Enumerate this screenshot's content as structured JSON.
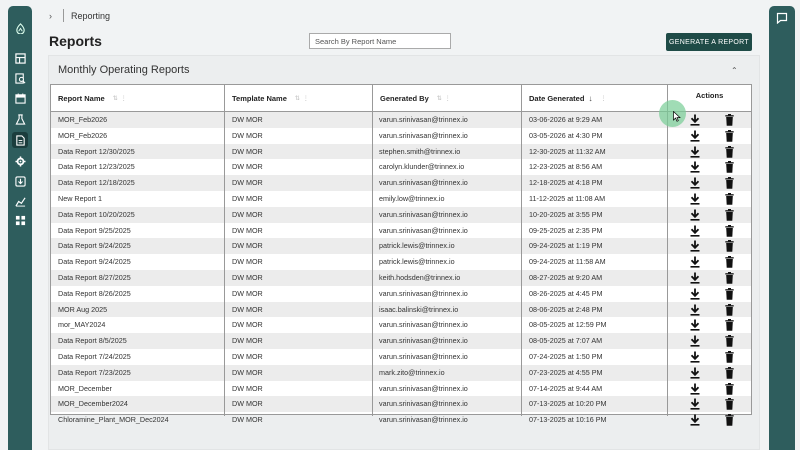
{
  "breadcrumb": {
    "chevron": "›",
    "label": "Reporting"
  },
  "page": {
    "title": "Reports"
  },
  "search": {
    "placeholder": "Search By Report Name"
  },
  "toolbar": {
    "generate_label": "GENERATE A REPORT"
  },
  "panel": {
    "title": "Monthly Operating Reports",
    "collapse_glyph": "⌃"
  },
  "table": {
    "columns": {
      "report_name": "Report Name",
      "template_name": "Template Name",
      "generated_by": "Generated By",
      "date_generated": "Date Generated",
      "actions": "Actions"
    },
    "rows": [
      {
        "name": "MOR_Feb2026",
        "template": "DW MOR",
        "by": "varun.srinivasan@trinnex.io",
        "date": "03-06-2026 at 9:29 AM"
      },
      {
        "name": "MOR_Feb2026",
        "template": "DW MOR",
        "by": "varun.srinivasan@trinnex.io",
        "date": "03-05-2026 at 4:30 PM"
      },
      {
        "name": "Data Report 12/30/2025",
        "template": "DW MOR",
        "by": "stephen.smith@trinnex.io",
        "date": "12-30-2025 at 11:32 AM"
      },
      {
        "name": "Data Report 12/23/2025",
        "template": "DW MOR",
        "by": "carolyn.klunder@trinnex.io",
        "date": "12-23-2025 at 8:56 AM"
      },
      {
        "name": "Data Report 12/18/2025",
        "template": "DW MOR",
        "by": "varun.srinivasan@trinnex.io",
        "date": "12-18-2025 at 4:18 PM"
      },
      {
        "name": "New Report 1",
        "template": "DW MOR",
        "by": "emily.low@trinnex.io",
        "date": "11-12-2025 at 11:08 AM"
      },
      {
        "name": "Data Report 10/20/2025",
        "template": "DW MOR",
        "by": "varun.srinivasan@trinnex.io",
        "date": "10-20-2025 at 3:55 PM"
      },
      {
        "name": "Data Report 9/25/2025",
        "template": "DW MOR",
        "by": "varun.srinivasan@trinnex.io",
        "date": "09-25-2025 at 2:35 PM"
      },
      {
        "name": "Data Report 9/24/2025",
        "template": "DW MOR",
        "by": "patrick.lewis@trinnex.io",
        "date": "09-24-2025 at 1:19 PM"
      },
      {
        "name": "Data Report 9/24/2025",
        "template": "DW MOR",
        "by": "patrick.lewis@trinnex.io",
        "date": "09-24-2025 at 11:58 AM"
      },
      {
        "name": "Data Report 8/27/2025",
        "template": "DW MOR",
        "by": "keith.hodsden@trinnex.io",
        "date": "08-27-2025 at 9:20 AM"
      },
      {
        "name": "Data Report 8/26/2025",
        "template": "DW MOR",
        "by": "varun.srinivasan@trinnex.io",
        "date": "08-26-2025 at 4:45 PM"
      },
      {
        "name": "MOR Aug 2025",
        "template": "DW MOR",
        "by": "isaac.balinski@trinnex.io",
        "date": "08-06-2025 at 2:48 PM"
      },
      {
        "name": "mor_MAY2024",
        "template": "DW MOR",
        "by": "varun.srinivasan@trinnex.io",
        "date": "08-05-2025 at 12:59 PM"
      },
      {
        "name": "Data Report 8/5/2025",
        "template": "DW MOR",
        "by": "varun.srinivasan@trinnex.io",
        "date": "08-05-2025 at 7:07 AM"
      },
      {
        "name": "Data Report 7/24/2025",
        "template": "DW MOR",
        "by": "varun.srinivasan@trinnex.io",
        "date": "07-24-2025 at 1:50 PM"
      },
      {
        "name": "Data Report 7/23/2025",
        "template": "DW MOR",
        "by": "mark.zito@trinnex.io",
        "date": "07-23-2025 at 4:55 PM"
      },
      {
        "name": "MOR_December",
        "template": "DW MOR",
        "by": "varun.srinivasan@trinnex.io",
        "date": "07-14-2025 at 9:44 AM"
      },
      {
        "name": "MOR_December2024",
        "template": "DW MOR",
        "by": "varun.srinivasan@trinnex.io",
        "date": "07-13-2025 at 10:20 PM"
      },
      {
        "name": "Chloramine_Plant_MOR_Dec2024",
        "template": "DW MOR",
        "by": "varun.srinivasan@trinnex.io",
        "date": "07-13-2025 at 10:16 PM"
      }
    ]
  },
  "nav_icons": [
    "logo-icon",
    "dashboard-icon",
    "search-report-icon",
    "calendar-icon",
    "lab-flask-icon",
    "reports-icon",
    "settings-gear-icon",
    "import-icon",
    "analytics-icon",
    "widgets-icon"
  ],
  "colors": {
    "nav_bg": "#2e5d5d",
    "primary_button": "#1f4b47",
    "cursor_highlight": "#78cd96"
  }
}
